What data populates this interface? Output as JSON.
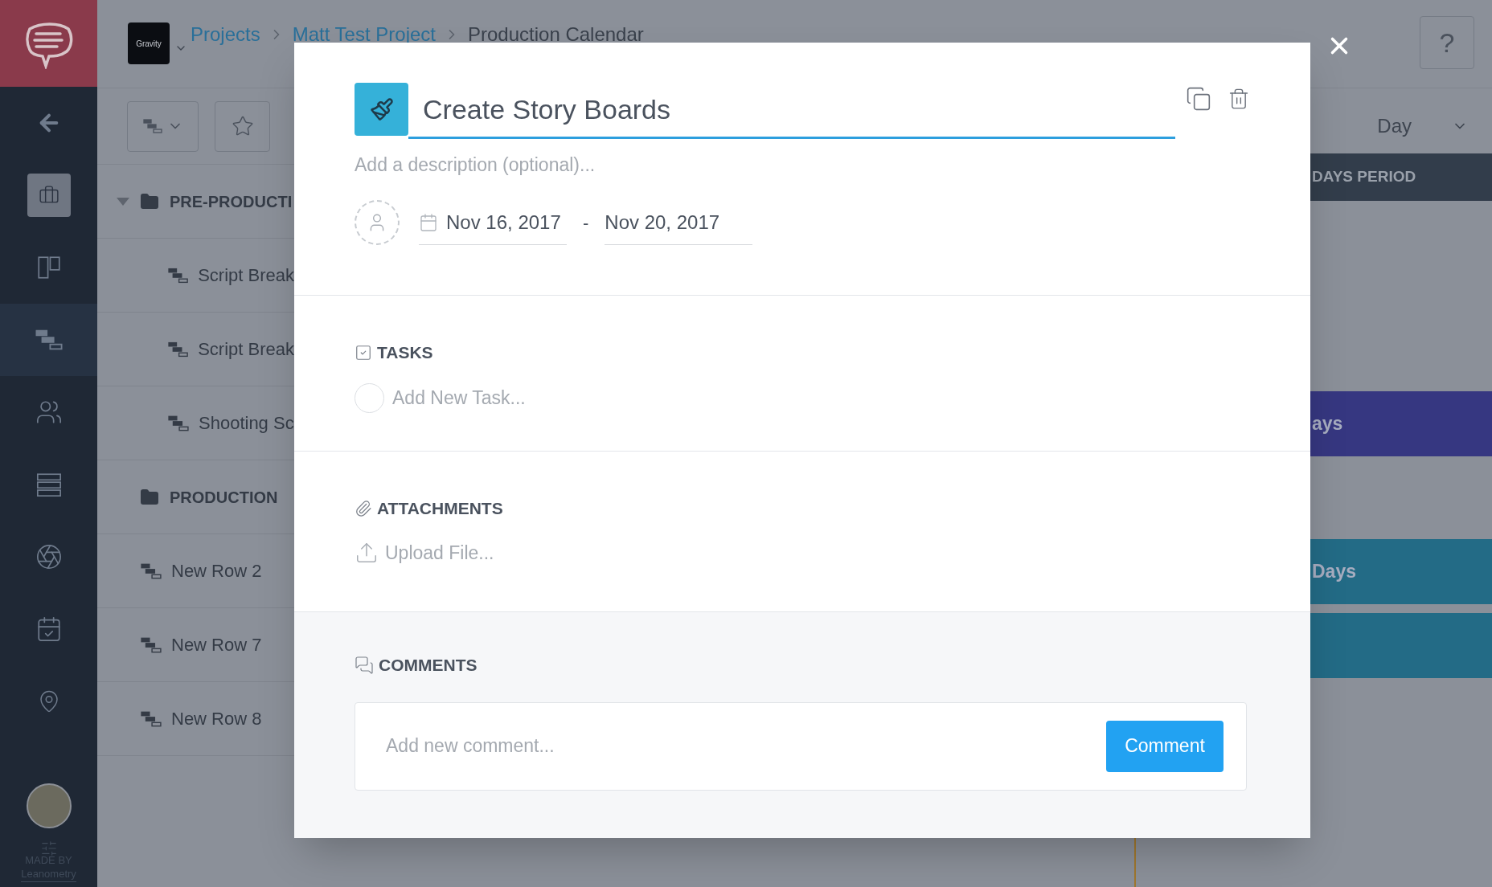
{
  "sidebar": {
    "items": [
      {
        "selected": false,
        "highlighted": false
      },
      {
        "selected": true,
        "highlighted": false
      },
      {
        "selected": false,
        "highlighted": false
      },
      {
        "selected": false,
        "highlighted": true
      },
      {
        "selected": false,
        "highlighted": false
      },
      {
        "selected": false,
        "highlighted": false
      },
      {
        "selected": false,
        "highlighted": false
      },
      {
        "selected": false,
        "highlighted": false
      },
      {
        "selected": false,
        "highlighted": false
      }
    ],
    "footer": [
      "MADE BY",
      "Leanometry"
    ]
  },
  "header": {
    "logo": "Gravity",
    "breadcrumb": [
      "Projects",
      "Matt Test Project",
      "Production Calendar"
    ],
    "help": "?"
  },
  "view_select": {
    "value": "Day"
  },
  "rows": [
    {
      "kind": "group",
      "label": "PRE-PRODUCTI",
      "expanded": true
    },
    {
      "kind": "sub",
      "label": "Script Break"
    },
    {
      "kind": "sub",
      "label": "Script Break"
    },
    {
      "kind": "sub",
      "label": "Shooting Sc"
    },
    {
      "kind": "group",
      "label": "PRODUCTION",
      "expanded": false
    },
    {
      "kind": "row",
      "label": "New Row 2"
    },
    {
      "kind": "row",
      "label": "New Row 7"
    },
    {
      "kind": "row",
      "label": "New Row 8"
    }
  ],
  "gantt_bars": [
    {
      "kind": "header",
      "label": "DAYS PERIOD",
      "color": "#323d4b"
    },
    {
      "kind": "bar",
      "label": "ays",
      "color": "#363781"
    },
    {
      "kind": "bar",
      "label": "Days",
      "color": "#236b86"
    },
    {
      "kind": "bar",
      "color": "#236b86"
    }
  ],
  "modal": {
    "title": "Create Story Boards",
    "description_placeholder": "Add a description (optional)...",
    "start_date": "Nov 16, 2017",
    "date_separator": "-",
    "end_date": "Nov 20, 2017",
    "tasks": {
      "heading": "TASKS",
      "new_task_placeholder": "Add New Task..."
    },
    "attachments": {
      "heading": "ATTACHMENTS",
      "upload": "Upload File..."
    },
    "comments": {
      "heading": "COMMENTS",
      "placeholder": "Add new comment...",
      "button": "Comment"
    }
  }
}
